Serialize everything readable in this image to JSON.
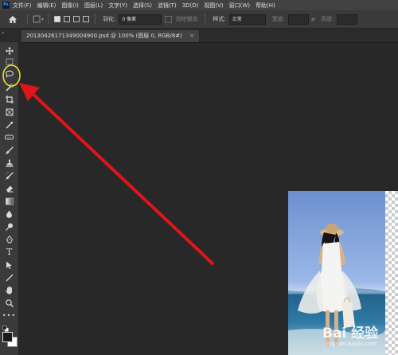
{
  "app": {
    "logo": "Ps"
  },
  "menu": [
    "文件(F)",
    "编辑(E)",
    "图像(I)",
    "图层(L)",
    "文字(Y)",
    "选择(S)",
    "滤镜(T)",
    "3D(D)",
    "视图(V)",
    "窗口(W)",
    "帮助(H)"
  ],
  "options": {
    "feather_label": "羽化:",
    "feather_value": "0 像素",
    "antialias_label": "消除锯齿",
    "style_label": "样式:",
    "style_value": "正常",
    "width_label": "宽度:",
    "height_label": "高度:"
  },
  "document": {
    "tab_title": "20130426171349004900.psd @ 100% (图层 0, RGB/8#)",
    "close_glyph": "×"
  },
  "tools": [
    "move-tool",
    "marquee-tool",
    "lasso-tool",
    "quick-select-tool",
    "crop-tool",
    "frame-tool",
    "eyedropper-tool",
    "healing-brush-tool",
    "brush-tool",
    "clone-stamp-tool",
    "history-brush-tool",
    "eraser-tool",
    "gradient-tool",
    "blur-tool",
    "dodge-tool",
    "pen-tool",
    "type-tool",
    "path-select-tool",
    "line-tool",
    "hand-tool",
    "zoom-tool",
    "more-tools"
  ],
  "image": {
    "watermark": "Bai 经验",
    "watermark_url": "jingyan.baidu.com"
  },
  "colors": {
    "highlight_circle": "#f2e21c",
    "arrow": "#e0141b",
    "foreground": "#1a1a1a",
    "background": "#ffffff"
  }
}
